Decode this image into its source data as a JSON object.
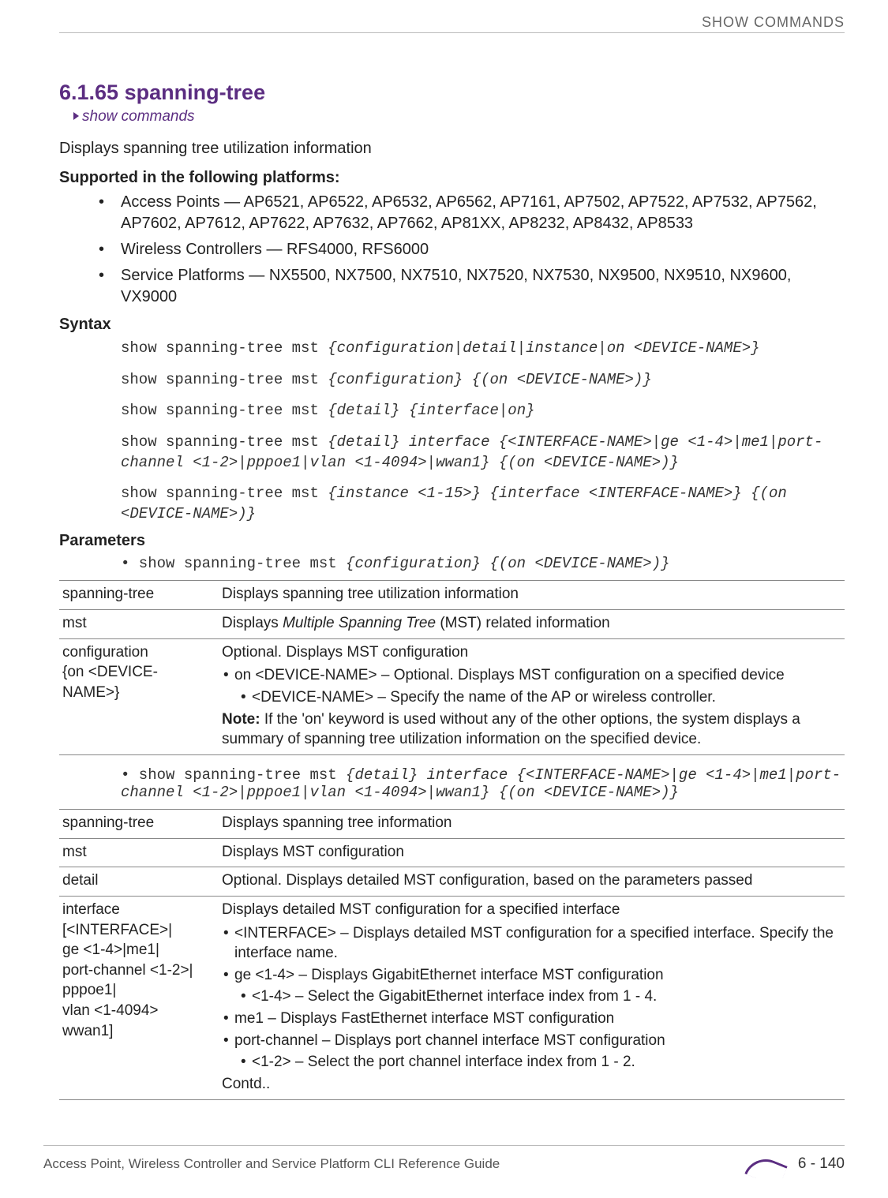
{
  "running_head": "SHOW COMMANDS",
  "title": "6.1.65 spanning-tree",
  "crumb": "show commands",
  "intro": "Displays spanning tree utilization information",
  "supported_head": "Supported in the following platforms:",
  "supported": [
    "Access Points — AP6521, AP6522, AP6532, AP6562, AP7161, AP7502, AP7522, AP7532, AP7562, AP7602, AP7612, AP7622, AP7632, AP7662, AP81XX, AP8232, AP8432, AP8533",
    "Wireless Controllers — RFS4000, RFS6000",
    "Service Platforms — NX5500, NX7500, NX7510, NX7520, NX7530, NX9500, NX9510, NX9600, VX9000"
  ],
  "syntax_head": "Syntax",
  "syntax": [
    {
      "plain": "show spanning-tree mst ",
      "ital": "{configuration|detail|instance|on <DEVICE-NAME>}"
    },
    {
      "plain": "show spanning-tree mst ",
      "ital": "{configuration} {(on <DEVICE-NAME>)}"
    },
    {
      "plain": "show spanning-tree mst ",
      "ital": "{detail} {interface|on}"
    },
    {
      "plain": "show spanning-tree mst ",
      "ital": "{detail} interface {<INTERFACE-NAME>|ge <1-4>|me1|port-channel <1-2>|pppoe1|vlan <1-4094>|wwan1} {(on <DEVICE-NAME>)}"
    },
    {
      "plain": "show spanning-tree mst ",
      "ital": "{instance <1-15>} {interface <INTERFACE-NAME>} {(on <DEVICE-NAME>)}"
    }
  ],
  "parameters_head": "Parameters",
  "params_intro_1_plain": "• show spanning-tree mst ",
  "params_intro_1_ital": "{configuration} {(on <DEVICE-NAME>)}",
  "table1": {
    "rows": [
      {
        "name": "spanning-tree",
        "desc_main": "Displays spanning tree utilization information"
      },
      {
        "name": "mst",
        "desc_main_pre": "Displays ",
        "desc_main_ital": "Multiple Spanning Tree",
        "desc_main_post": " (MST) related information"
      },
      {
        "name": "configuration\n{on <DEVICE-NAME>}",
        "desc_main": "Optional. Displays MST configuration",
        "bullets": [
          "on <DEVICE-NAME> – Optional. Displays MST configuration on a specified device",
          "<DEVICE-NAME> – Specify the name of the AP or wireless controller."
        ],
        "note_label": "Note:",
        "note_text": " If the 'on' keyword is used without any of the other options, the system displays a summary of spanning tree utilization information on the specified device."
      }
    ]
  },
  "params_intro_2_plain": "• show spanning-tree mst ",
  "params_intro_2_ital": "{detail} interface {<INTERFACE-NAME>|ge <1-4>|me1|port-channel <1-2>|pppoe1|vlan <1-4094>|wwan1} {(on <DEVICE-NAME>)}",
  "table2": {
    "rows": [
      {
        "name": "spanning-tree",
        "desc_main": "Displays spanning tree information"
      },
      {
        "name": "mst",
        "desc_main": "Displays MST configuration"
      },
      {
        "name": "detail",
        "desc_main": "Optional. Displays detailed MST configuration, based on the parameters passed"
      },
      {
        "name": "interface\n[<INTERFACE>|\nge <1-4>|me1|\nport-channel <1-2>|\npppoe1|\nvlan <1-4094>\nwwan1]",
        "desc_main": "Displays detailed MST configuration for a specified interface",
        "bullets": [
          "<INTERFACE> – Displays detailed MST configuration for a specified interface. Specify the interface name.",
          "ge <1-4> – Displays GigabitEthernet interface MST configuration",
          "<1-4> – Select the GigabitEthernet interface index from 1 - 4.",
          "me1 – Displays FastEthernet interface MST configuration",
          "port-channel – Displays port channel interface MST configuration",
          "<1-2> – Select the port channel interface index from 1 - 2."
        ],
        "contd": "Contd.."
      }
    ]
  },
  "footer_left": "Access Point, Wireless Controller and Service Platform CLI Reference Guide",
  "footer_page": "6 - 140"
}
